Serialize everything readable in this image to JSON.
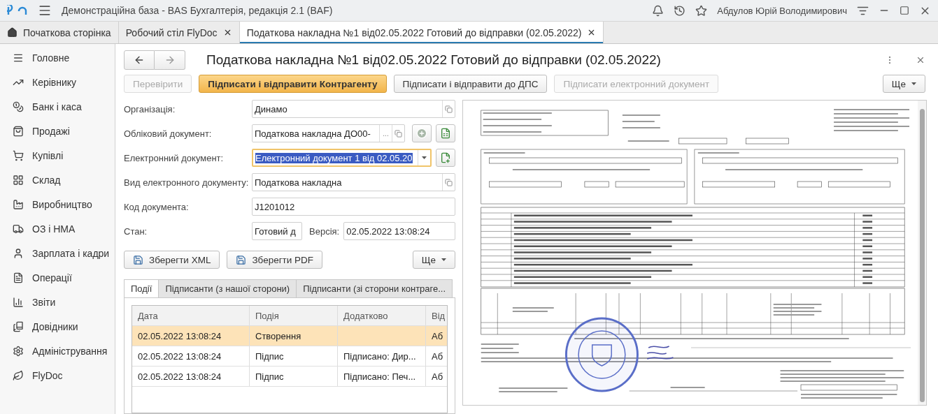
{
  "window": {
    "title": "Демонстраційна база - BAS Бухгалтерія, редакція 2.1  (BAF)",
    "user": "Абдулов Юрій Володимирович"
  },
  "tabs": [
    {
      "label": "Початкова сторінка",
      "kind": "home",
      "selected": false
    },
    {
      "label": "Робочий стіл FlyDoc",
      "kind": "closable",
      "selected": false
    },
    {
      "label": "Податкова накладна №1 від02.05.2022 Готовий до відправки (02.05.2022)",
      "kind": "closable",
      "selected": true
    }
  ],
  "sidebar": {
    "items": [
      {
        "label": "Головне",
        "kind": "menu"
      },
      {
        "label": "Керівнику",
        "kind": "trend"
      },
      {
        "label": "Банк і каса",
        "kind": "coins"
      },
      {
        "label": "Продажі",
        "kind": "bag"
      },
      {
        "label": "Купівлі",
        "kind": "cart"
      },
      {
        "label": "Склад",
        "kind": "grid"
      },
      {
        "label": "Виробництво",
        "kind": "factory"
      },
      {
        "label": "ОЗ і НМА",
        "kind": "truck"
      },
      {
        "label": "Зарплата і кадри",
        "kind": "user"
      },
      {
        "label": "Операції",
        "kind": "ledger"
      },
      {
        "label": "Звіти",
        "kind": "chart"
      },
      {
        "label": "Довідники",
        "kind": "books"
      },
      {
        "label": "Адміністрування",
        "kind": "gear"
      },
      {
        "label": "FlyDoc",
        "kind": "leaf"
      }
    ]
  },
  "form": {
    "title": "Податкова накладна №1 від02.05.2022 Готовий до відправки (02.05.2022)",
    "commands": [
      {
        "label": "Перевірити",
        "kind": "plain",
        "disabled": true
      },
      {
        "label": "Підписати і відправити Контрагенту",
        "kind": "primary",
        "disabled": false
      },
      {
        "label": "Підписати і відправити до ДПС",
        "kind": "plain",
        "disabled": false
      },
      {
        "label": "Підписати електронний документ",
        "kind": "plain",
        "disabled": true
      }
    ],
    "more_label": "Ще",
    "fields": [
      {
        "kind": "ref",
        "label": "Організація:",
        "value": "Динамо",
        "focused": false
      },
      {
        "kind": "ref-actions",
        "label": "Обліковий документ:",
        "value": "Податкова накладна ДО00-",
        "choose": "...",
        "focused": false
      },
      {
        "kind": "dropdown",
        "label": "Електронний документ:",
        "value": "Електронний документ 1 від 02.05.20",
        "focused": true
      },
      {
        "kind": "ref",
        "label": "Вид електронного документу:",
        "value": "Податкова накладна",
        "focused": false
      },
      {
        "kind": "text",
        "label": "Код документа:",
        "value": "J1201012",
        "focused": false
      },
      {
        "kind": "state",
        "label": "Стан:",
        "value": "Готовий д",
        "extra_label": "Версія:",
        "extra_value": "02.05.2022 13:08:24",
        "focused": false
      }
    ],
    "save_buttons": [
      "Зберегти XML",
      "Зберегти PDF"
    ],
    "more_label_2": "Ще",
    "subtabs": [
      {
        "label": "Події",
        "selected": true
      },
      {
        "label": "Підписанти (з нашої сторони)",
        "selected": false
      },
      {
        "label": "Підписанти (зі сторони контраге...",
        "selected": false
      }
    ],
    "table": {
      "columns": [
        "Дата",
        "Подія",
        "Додатково",
        "Від"
      ],
      "rows": [
        {
          "cells": [
            "02.05.2022 13:08:24",
            "Створення",
            null,
            "Аб"
          ],
          "selected": true
        },
        {
          "cells": [
            "02.05.2022 13:08:24",
            "Підпис",
            "Підписано: Дир...",
            "Аб"
          ],
          "selected": false
        },
        {
          "cells": [
            "02.05.2022 13:08:24",
            "Підпис",
            "Підписано: Печ...",
            "Аб"
          ],
          "selected": false
        }
      ]
    }
  }
}
